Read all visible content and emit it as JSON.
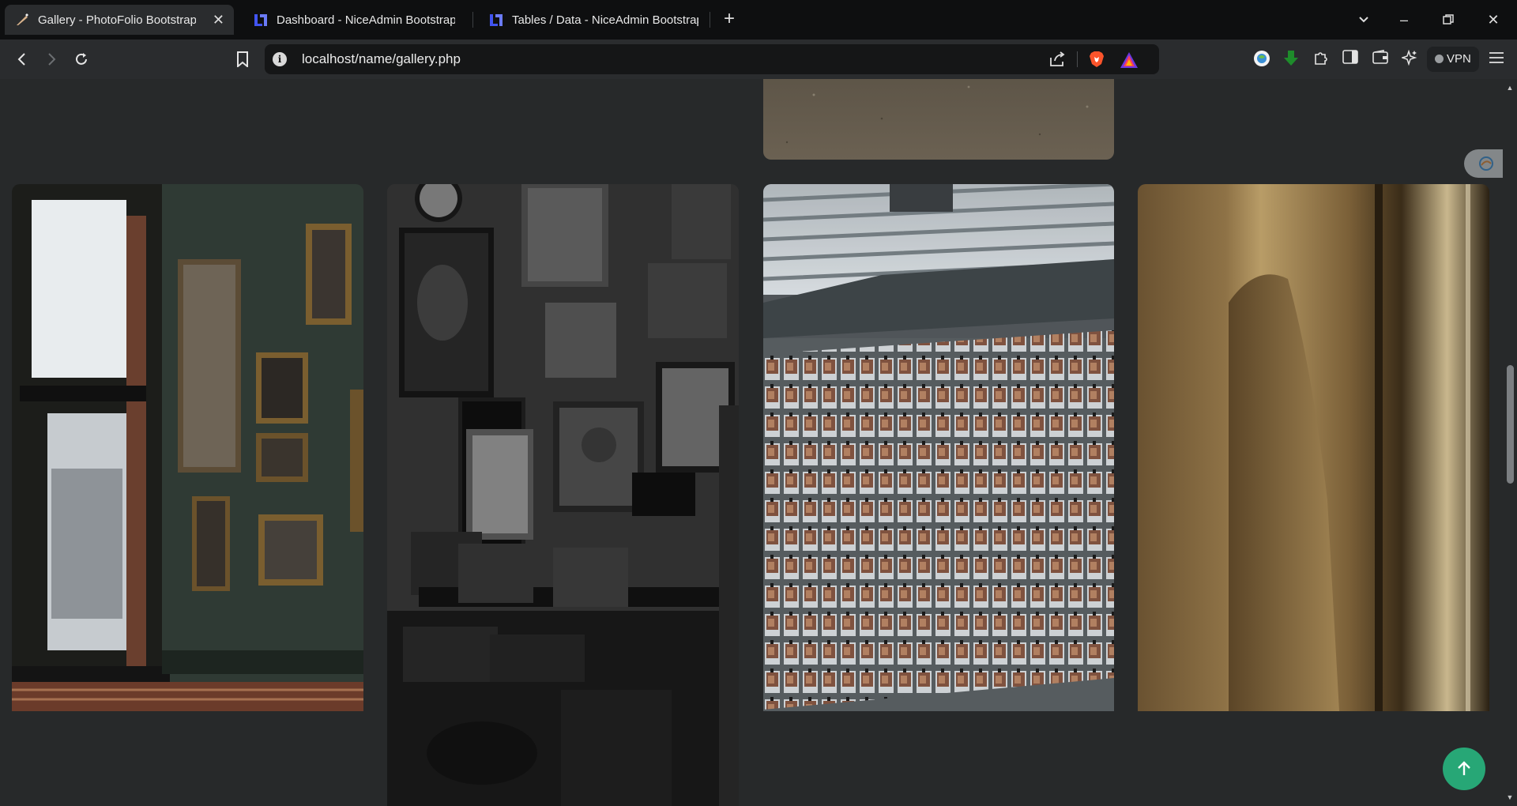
{
  "browser": {
    "tabs": [
      {
        "title": "Gallery - PhotoFolio Bootstrap",
        "active": true
      },
      {
        "title": "Dashboard - NiceAdmin Bootstrap T",
        "active": false
      },
      {
        "title": "Tables / Data - NiceAdmin Bootstrap",
        "active": false
      }
    ],
    "url": "localhost/name/gallery.php",
    "vpn_label": "VPN"
  },
  "colors": {
    "page_bg": "#27292a",
    "accent": "#27a776"
  },
  "gallery": {
    "items": [
      {
        "subject": "road-pavement",
        "state": "normal"
      },
      {
        "subject": "framed-photos-wall-window",
        "state": "normal"
      },
      {
        "subject": "cluttered-memorabilia-room",
        "state": "hovered"
      },
      {
        "subject": "polaroid-photo-wall",
        "state": "normal"
      },
      {
        "subject": "curved-wall-column",
        "state": "normal"
      }
    ]
  },
  "icons": {
    "expand": "expand-icon",
    "link": "link-icon",
    "back_to_top": "arrow-up-icon"
  }
}
